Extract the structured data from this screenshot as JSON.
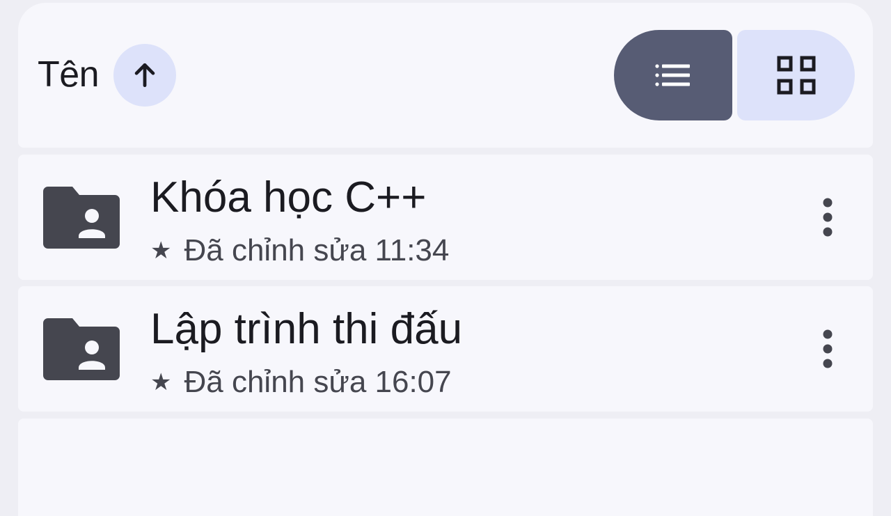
{
  "header": {
    "sort_label": "Tên",
    "sort_icon": "arrow-up-icon",
    "view_list_icon": "list-view-icon",
    "view_grid_icon": "grid-view-icon",
    "active_view": "list"
  },
  "items": [
    {
      "icon": "shared-folder-icon",
      "title": "Khóa học C++",
      "starred": true,
      "star": "★",
      "meta": "Đã chỉnh sửa 11:34"
    },
    {
      "icon": "shared-folder-icon",
      "title": "Lập trình thi đấu",
      "starred": true,
      "star": "★",
      "meta": "Đã chỉnh sửa 16:07"
    }
  ],
  "colors": {
    "background": "#eeeef4",
    "card": "#f7f7fc",
    "accent_container": "#dde2fa",
    "active_toggle": "#575c74",
    "icon": "#45464f",
    "text": "#1b1b21"
  }
}
